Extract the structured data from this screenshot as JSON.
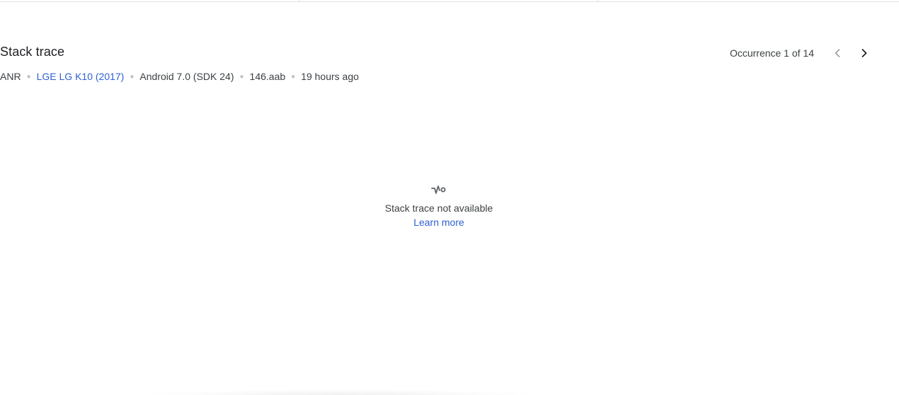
{
  "section": {
    "title": "Stack trace"
  },
  "occurrence": {
    "label": "Occurrence 1 of 14",
    "prev_icon": "chevron-left-icon",
    "next_icon": "chevron-right-icon"
  },
  "meta": {
    "type": "ANR",
    "device": "LGE LG K10 (2017)",
    "os": "Android 7.0 (SDK 24)",
    "build": "146.aab",
    "time": "19 hours ago"
  },
  "empty_state": {
    "icon": "broken-trace-icon",
    "message": "Stack trace not available",
    "link": "Learn more"
  },
  "colors": {
    "link": "#2f5fd0",
    "text": "#3c4043",
    "title": "#202124"
  }
}
